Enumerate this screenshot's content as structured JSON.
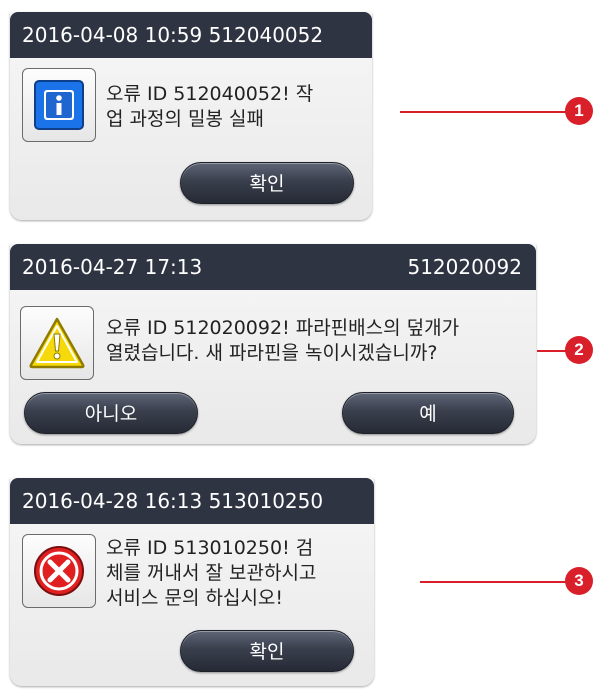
{
  "dialogs": [
    {
      "title_left": "2016-04-08 10:59 512040052",
      "title_right": "",
      "icon": "info-icon",
      "message_lines": [
        "오류 ID 512040052! 작",
        "업 과정의 밀봉 실패"
      ],
      "buttons": [
        "확인"
      ],
      "callout": "1"
    },
    {
      "title_left": "2016-04-27 17:13",
      "title_right": "512020092",
      "icon": "warning-icon",
      "message_lines": [
        "오류 ID 512020092! 파라핀배스의 덮개가",
        "열렸습니다. 새 파라핀을 녹이시겠습니까?"
      ],
      "buttons": [
        "아니오",
        "예"
      ],
      "callout": "2"
    },
    {
      "title_left": "2016-04-28 16:13 513010250",
      "title_right": "",
      "icon": "error-icon",
      "message_lines": [
        "오류 ID 513010250! 검",
        "체를 꺼내서 잘 보관하시고",
        "서비스 문의 하십시오!"
      ],
      "buttons": [
        "확인"
      ],
      "callout": "3"
    }
  ],
  "colors": {
    "titlebar": "#2f3442",
    "callout": "#d9202a",
    "info_blue": "#1a73e8",
    "warning_yellow": "#f5d90a",
    "error_red": "#e02020"
  }
}
